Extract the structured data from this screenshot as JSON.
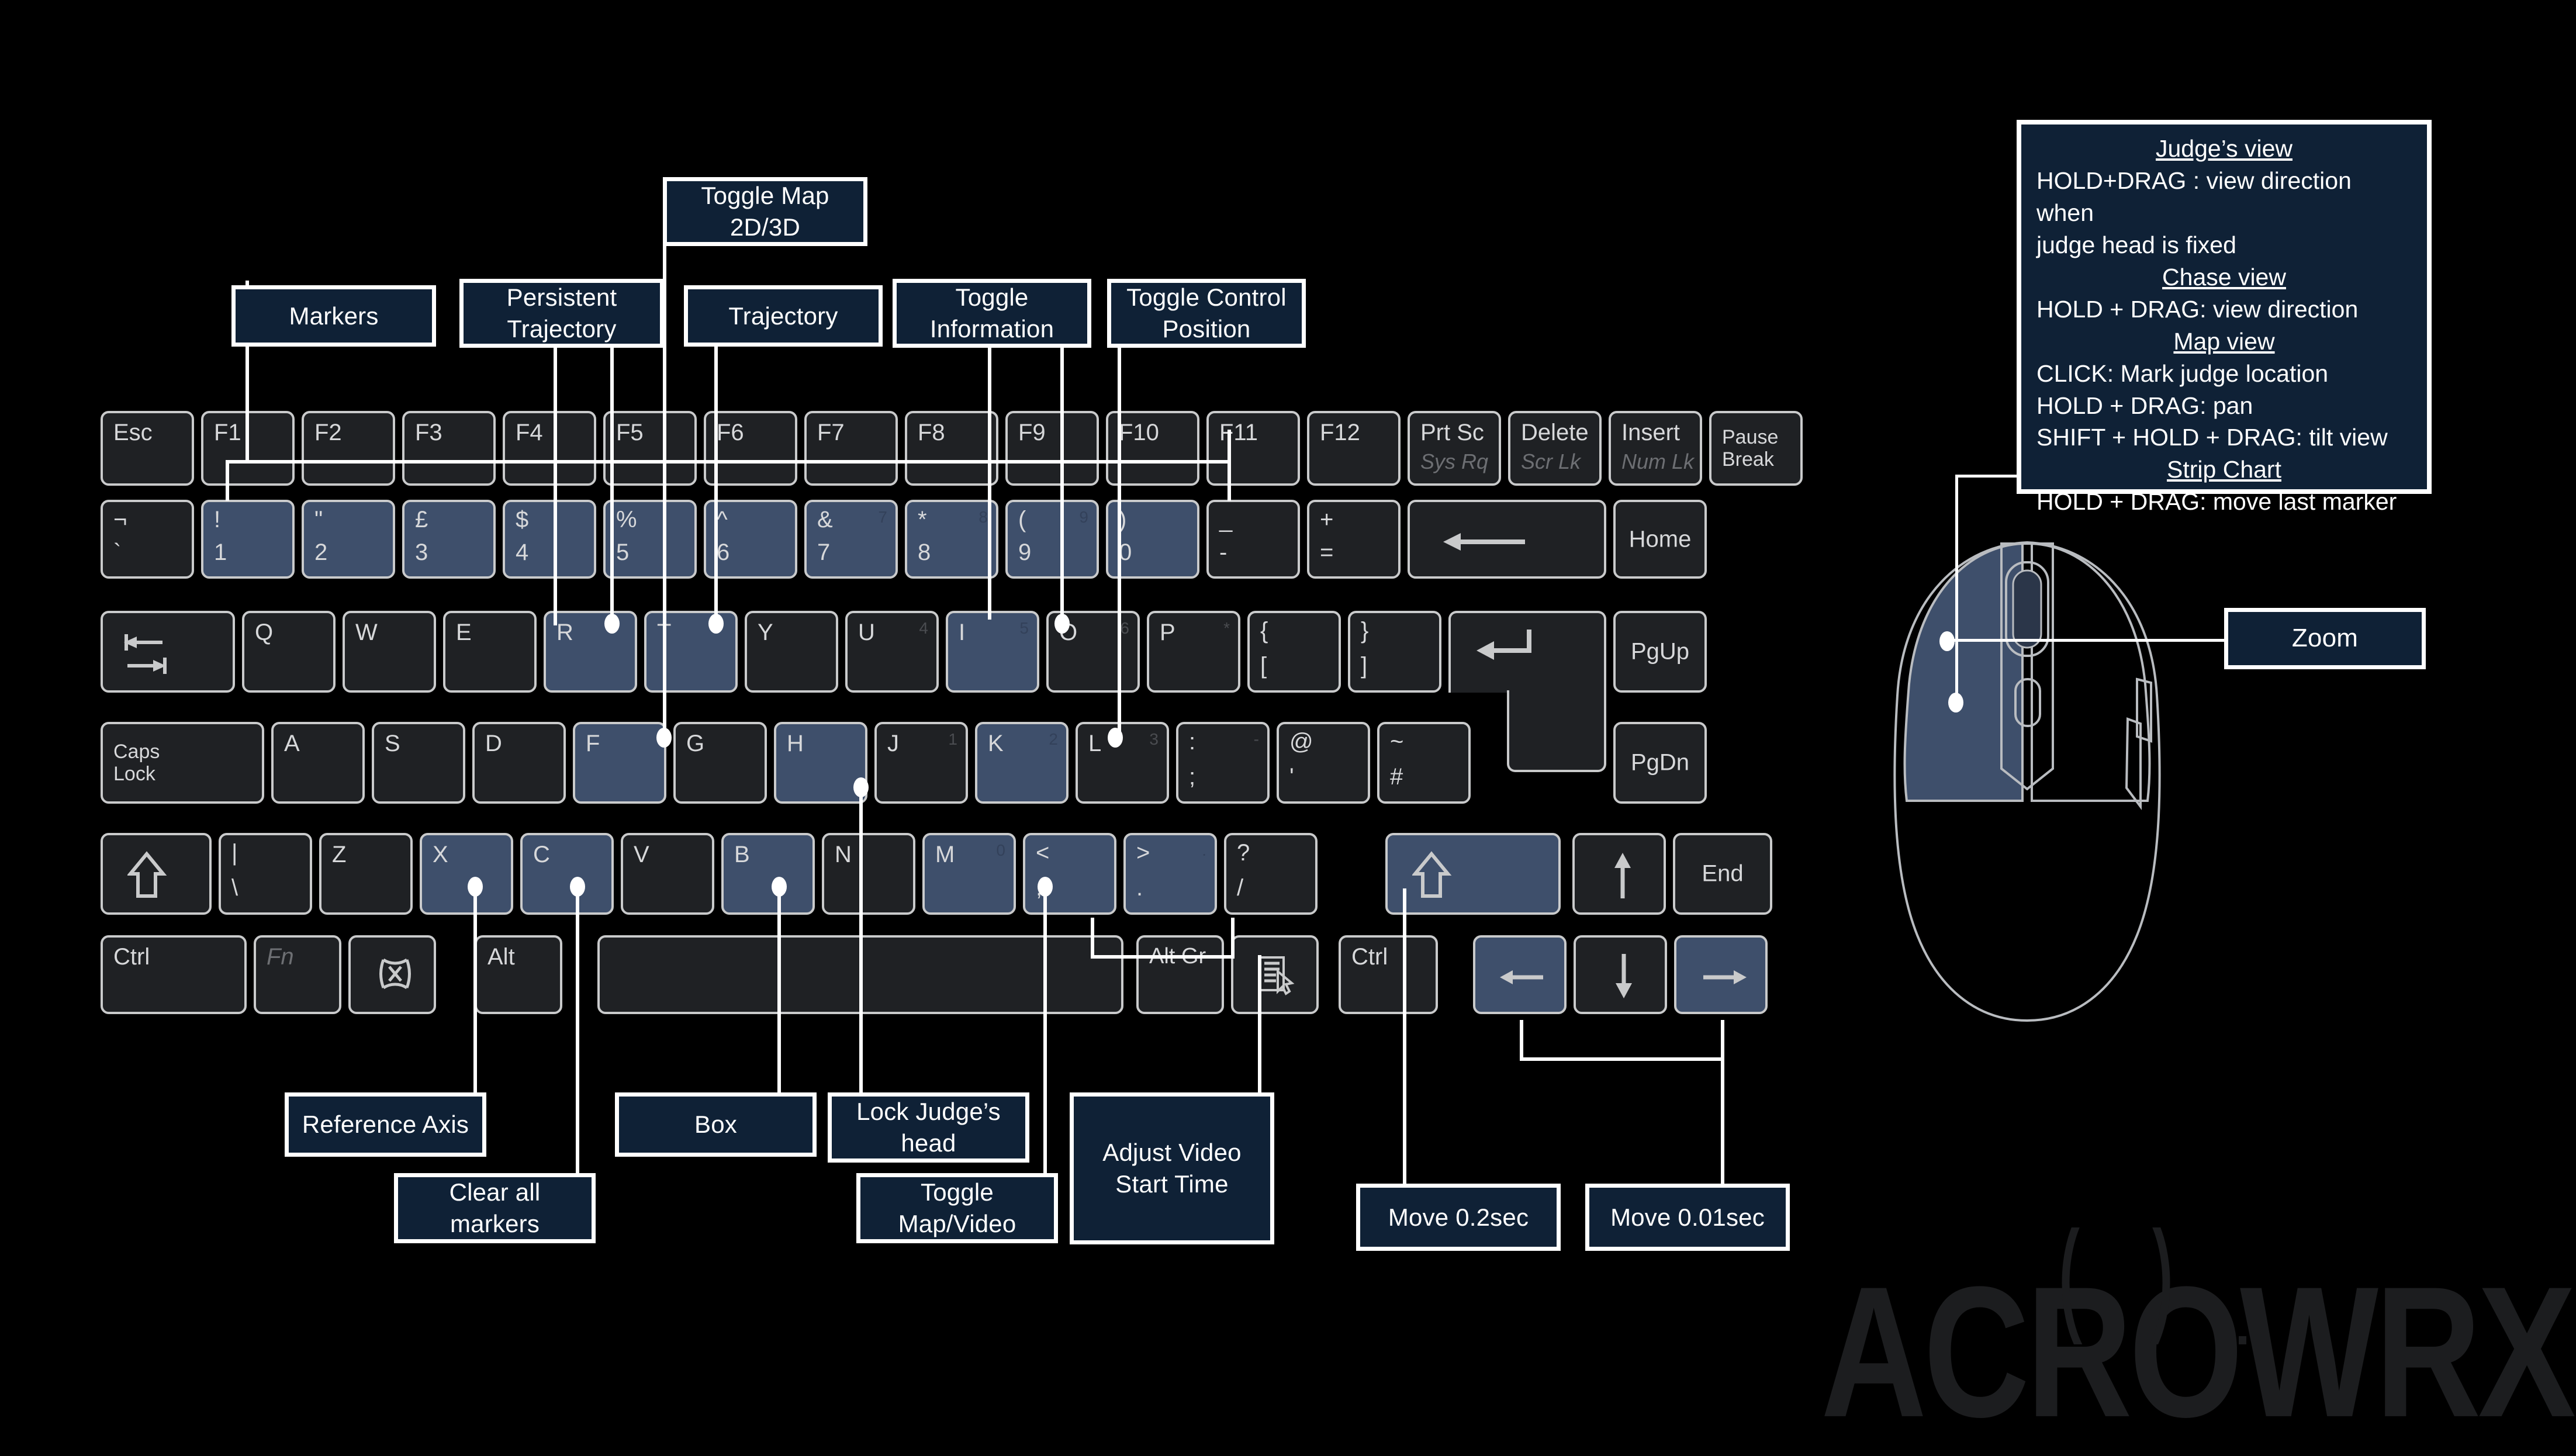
{
  "brand": {
    "logo_text": "ACROWRX",
    "logo_color": "#1c1d1f"
  },
  "theme": {
    "background": "#000000",
    "callout_fill": "#0f2136",
    "callout_border": "#ffffff",
    "key_fill": "#1f2124",
    "key_highlight_fill": "#3e4f6b",
    "key_border": "#c9cacb"
  },
  "legend": {
    "lines": [
      {
        "text": "Judge’s view",
        "style": "heading"
      },
      {
        "text": "HOLD+DRAG : view  direction when",
        "style": "body"
      },
      {
        "text": "judge head is fixed",
        "style": "body"
      },
      {
        "text": "Chase view",
        "style": "heading"
      },
      {
        "text": "HOLD + DRAG:  view  direction",
        "style": "body"
      },
      {
        "text": "Map view",
        "style": "heading"
      },
      {
        "text": "CLICK: Mark judge location",
        "style": "body"
      },
      {
        "text": "HOLD + DRAG: pan",
        "style": "body"
      },
      {
        "text": "SHIFT + HOLD + DRAG:  tilt view",
        "style": "body"
      },
      {
        "text": "Strip Chart",
        "style": "heading"
      },
      {
        "text": "HOLD + DRAG:  move last marker",
        "style": "body"
      }
    ]
  },
  "callouts": {
    "markers": "Markers",
    "persistent_trajectory": "Persistent\nTrajectory",
    "toggle_map_2d3d": "Toggle Map\n2D/3D",
    "trajectory": "Trajectory",
    "toggle_information": "Toggle\nInformation",
    "toggle_control_position": "Toggle Control\nPosition",
    "reference_axis": "Reference Axis",
    "clear_all_markers": "Clear all\nmarkers",
    "box": "Box",
    "lock_judges_head": "Lock Judge’s\nhead",
    "toggle_map_video": "Toggle\nMap/Video",
    "adjust_video_start_time": "Adjust Video\nStart Time",
    "move_02sec": "Move 0.2sec",
    "move_001sec": "Move 0.01sec",
    "zoom": "Zoom"
  },
  "keyboard": {
    "function_row": [
      {
        "label": "Esc",
        "highlight": false
      },
      {
        "label": "F1",
        "highlight": false
      },
      {
        "label": "F2",
        "highlight": false
      },
      {
        "label": "F3",
        "highlight": false
      },
      {
        "label": "F4",
        "highlight": false
      },
      {
        "label": "F5",
        "highlight": false
      },
      {
        "label": "F6",
        "highlight": false
      },
      {
        "label": "F7",
        "highlight": false
      },
      {
        "label": "F8",
        "highlight": false
      },
      {
        "label": "F9",
        "highlight": false
      },
      {
        "label": "F10",
        "highlight": false
      },
      {
        "label": "F11",
        "highlight": false
      },
      {
        "label": "F12",
        "highlight": false
      },
      {
        "label": "Prt Sc",
        "sub": "Sys Rq",
        "highlight": false
      },
      {
        "label": "Delete",
        "sub": "Scr Lk",
        "highlight": false
      },
      {
        "label": "Insert",
        "sub": "Num Lk",
        "highlight": false
      },
      {
        "label": "Pause\nBreak",
        "highlight": false
      }
    ],
    "number_row": [
      {
        "top": "¬",
        "bottom": "`",
        "highlight": false
      },
      {
        "top": "!",
        "bottom": "1",
        "highlight": true
      },
      {
        "top": "\"",
        "bottom": "2",
        "highlight": true
      },
      {
        "top": "£",
        "bottom": "3",
        "highlight": true
      },
      {
        "top": "$",
        "bottom": "4",
        "highlight": true
      },
      {
        "top": "%",
        "bottom": "5",
        "highlight": true
      },
      {
        "top": "^",
        "bottom": "6",
        "highlight": true
      },
      {
        "top": "&",
        "bottom": "7",
        "numpad": "7",
        "highlight": true
      },
      {
        "top": "*",
        "bottom": "8",
        "numpad": "8",
        "highlight": true
      },
      {
        "top": "(",
        "bottom": "9",
        "numpad": "9",
        "highlight": true
      },
      {
        "top": ")",
        "bottom": "0",
        "highlight": true
      },
      {
        "top": "_",
        "bottom": "-",
        "highlight": false
      },
      {
        "top": "+",
        "bottom": "=",
        "highlight": false
      },
      {
        "label": "backspace-arrow",
        "icon": "arrow-left",
        "highlight": false
      },
      {
        "label": "Home",
        "highlight": false
      }
    ],
    "qwerty_row": [
      {
        "label": "tab-icon",
        "icon": "tab",
        "highlight": false
      },
      {
        "label": "Q",
        "highlight": false
      },
      {
        "label": "W",
        "highlight": false
      },
      {
        "label": "E",
        "highlight": false
      },
      {
        "label": "R",
        "highlight": true
      },
      {
        "label": "T",
        "highlight": true
      },
      {
        "label": "Y",
        "highlight": false
      },
      {
        "label": "U",
        "numpad": "4",
        "highlight": false
      },
      {
        "label": "I",
        "numpad": "5",
        "highlight": true
      },
      {
        "label": "O",
        "numpad": "6",
        "highlight": false
      },
      {
        "label": "P",
        "numpad": "*",
        "highlight": false
      },
      {
        "top": "{",
        "bottom": "[",
        "highlight": false
      },
      {
        "top": "}",
        "bottom": "]",
        "highlight": false
      },
      {
        "label": "enter-icon",
        "icon": "enter",
        "highlight": false
      },
      {
        "label": "PgUp",
        "highlight": false
      }
    ],
    "home_row": [
      {
        "label": "Caps\nLock",
        "highlight": false
      },
      {
        "label": "A",
        "highlight": false
      },
      {
        "label": "S",
        "highlight": false
      },
      {
        "label": "D",
        "highlight": false
      },
      {
        "label": "F",
        "highlight": true
      },
      {
        "label": "G",
        "highlight": false
      },
      {
        "label": "H",
        "highlight": true
      },
      {
        "label": "J",
        "numpad": "1",
        "highlight": false
      },
      {
        "label": "K",
        "numpad": "2",
        "highlight": true
      },
      {
        "label": "L",
        "numpad": "3",
        "highlight": false
      },
      {
        "top": ":",
        "bottom": ";",
        "numpad": "-",
        "highlight": false
      },
      {
        "top": "@",
        "bottom": "'",
        "highlight": false
      },
      {
        "top": "~",
        "bottom": "#",
        "highlight": false
      },
      {
        "label": "PgDn",
        "highlight": false
      }
    ],
    "shift_row": [
      {
        "label": "shift-icon",
        "icon": "shift",
        "highlight": false
      },
      {
        "top": "|",
        "bottom": "\\",
        "highlight": false
      },
      {
        "label": "Z",
        "highlight": false
      },
      {
        "label": "X",
        "highlight": true
      },
      {
        "label": "C",
        "highlight": true
      },
      {
        "label": "V",
        "highlight": false
      },
      {
        "label": "B",
        "highlight": true
      },
      {
        "label": "N",
        "highlight": false
      },
      {
        "label": "M",
        "numpad": "0",
        "highlight": true
      },
      {
        "top": "<",
        "bottom": ",",
        "highlight": true
      },
      {
        "top": ">",
        "bottom": ".",
        "numpad": ".",
        "highlight": true
      },
      {
        "top": "?",
        "bottom": "/",
        "highlight": false
      },
      {
        "label": "right-shift-icon",
        "icon": "shift",
        "highlight": true
      },
      {
        "label": "arrow-up-icon",
        "icon": "up",
        "highlight": false
      },
      {
        "label": "End",
        "highlight": false
      }
    ],
    "bottom_row": [
      {
        "label": "Ctrl",
        "highlight": false
      },
      {
        "label": "Fn",
        "dim": true,
        "highlight": false
      },
      {
        "label": "win-icon",
        "icon": "win",
        "highlight": false
      },
      {
        "label": "Alt",
        "highlight": false
      },
      {
        "label": "space",
        "highlight": false
      },
      {
        "label": "Alt Gr",
        "highlight": false
      },
      {
        "label": "menu-icon",
        "icon": "menu",
        "highlight": false
      },
      {
        "label": "Ctrl",
        "highlight": false
      },
      {
        "label": "arrow-left-icon",
        "icon": "left",
        "highlight": true
      },
      {
        "label": "arrow-down-icon",
        "icon": "down",
        "highlight": false
      },
      {
        "label": "arrow-right-icon",
        "icon": "right",
        "highlight": true
      }
    ]
  },
  "mouse": {
    "left_button_highlighted": true,
    "scroll_wheel_label": "Zoom"
  }
}
